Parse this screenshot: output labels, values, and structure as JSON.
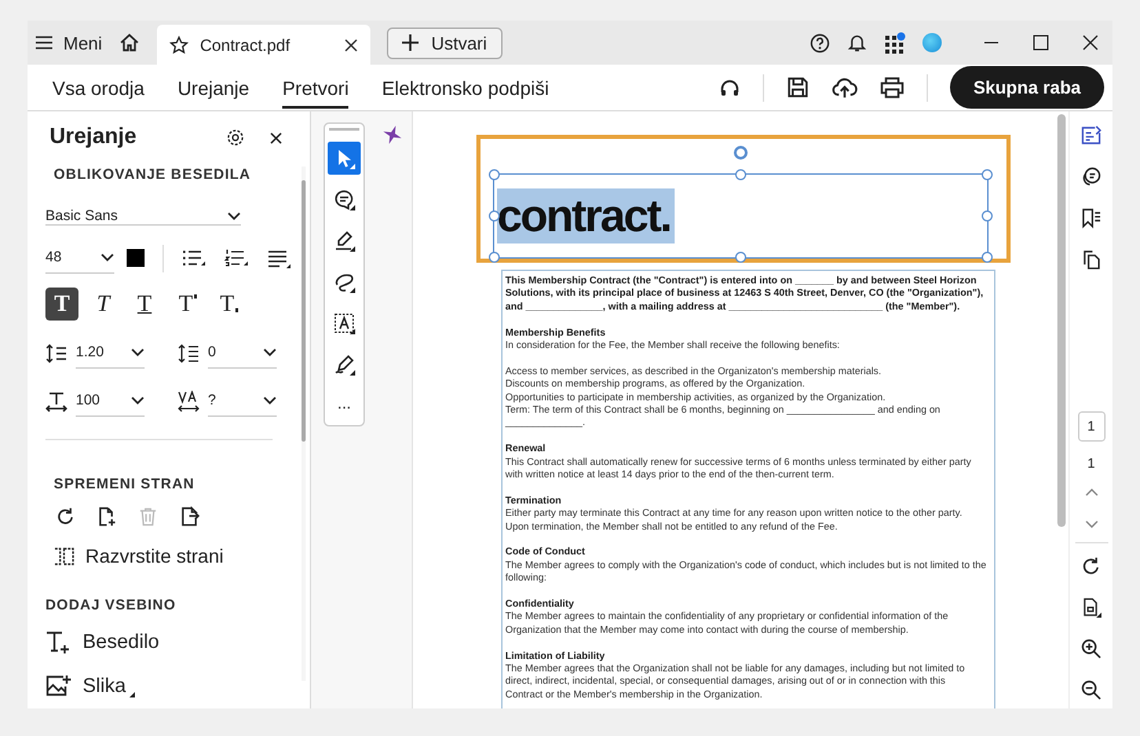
{
  "title_bar": {
    "menu_label": "Meni",
    "tabs": [
      {
        "label": "Contract.pdf",
        "selected": true
      }
    ],
    "create_button": "Ustvari"
  },
  "toolbar": {
    "tabs": [
      {
        "label": "Vsa orodja",
        "selected": false
      },
      {
        "label": "Urejanje",
        "selected": false
      },
      {
        "label": "Pretvori",
        "selected": true
      },
      {
        "label": "Elektronsko podpiši",
        "selected": false
      }
    ],
    "share_button": "Skupna raba"
  },
  "panel": {
    "title": "Urejanje",
    "format_heading": "OBLIKOVANJE BESEDILA",
    "font": "Basic Sans",
    "font_size": "48",
    "text_styles": [
      {
        "kind": "bold",
        "glyph": "T",
        "selected": true
      },
      {
        "kind": "italic",
        "glyph": "T",
        "selected": false
      },
      {
        "kind": "underline",
        "glyph": "T",
        "selected": false
      },
      {
        "kind": "superscript",
        "glyph": "T",
        "selected": false
      },
      {
        "kind": "subscript",
        "glyph": "T",
        "selected": false
      }
    ],
    "line_spacing": "1.20",
    "paragraph_spacing": "0",
    "horizontal_scale": "100",
    "character_spacing": "?",
    "page_heading": "SPREMENI STRAN",
    "page_tools": [
      {
        "kind": "rotate",
        "disabled": false
      },
      {
        "kind": "insert",
        "disabled": false
      },
      {
        "kind": "delete",
        "disabled": true
      },
      {
        "kind": "extract",
        "disabled": false
      }
    ],
    "organize_label": "Razvrstite strani",
    "add_heading": "DODAJ VSEBINO",
    "add_text": "Besedilo",
    "add_image": "Slika"
  },
  "tools": {
    "items": [
      {
        "kind": "select",
        "selected": true
      },
      {
        "kind": "comment",
        "selected": false
      },
      {
        "kind": "highlight",
        "selected": false
      },
      {
        "kind": "draw",
        "selected": false
      },
      {
        "kind": "textbox",
        "selected": false
      },
      {
        "kind": "sign",
        "selected": false
      }
    ],
    "more": "..."
  },
  "document": {
    "heading": "contract.",
    "heading_selected": true,
    "blocks": [
      {
        "kind": "bold",
        "lines": [
          "This Membership Contract (the \"Contract\") is entered into on _______ by and between Steel Horizon",
          "Solutions, with its principal place of business at 12463 S 40th Street, Denver, CO (the \"Organization\"),",
          "and ______________, with a mailing address at ____________________________ (the \"Member\")."
        ]
      },
      {
        "kind": "section",
        "heading": "Membership Benefits",
        "lines": [
          "In consideration for the Fee, the Member shall receive the following benefits:"
        ]
      },
      {
        "kind": "plain",
        "lines": [
          "Access to member services, as described in the Organizaton's membership materials.",
          "Discounts on membership programs, as offered by the Organization.",
          "Opportunities to participate in membership activities, as organized by the Organization.",
          "Term: The term of this Contract shall be 6 months, beginning on ________________ and ending on",
          "______________."
        ]
      },
      {
        "kind": "section",
        "heading": "Renewal",
        "lines": [
          "This Contract shall automatically renew for successive terms of 6 months unless terminated by either party",
          "with written notice at least 14 days prior to the end of the then-current term."
        ]
      },
      {
        "kind": "section",
        "heading": "Termination",
        "lines": [
          "Either party may terminate this Contract at any time for any reason upon written notice to the other party.",
          "Upon termination, the Member shall not be entitled to any refund of the Fee."
        ]
      },
      {
        "kind": "section",
        "heading": "Code of Conduct",
        "lines": [
          "The Member agrees to comply with the Organization's code of conduct, which includes but is not limited to the",
          "following:"
        ]
      },
      {
        "kind": "section",
        "heading": "Confidentiality",
        "lines": [
          "The Member agrees to maintain the confidentiality of any proprietary or confidential information of the",
          "Organization that the Member may come into contact with during the course of membership."
        ]
      },
      {
        "kind": "section",
        "heading": "Limitation of Liability",
        "lines": [
          "The Member agrees that the Organization shall not be liable for any damages, including but not limited to",
          "direct, indirect, incidental, special, or consequential damages, arising out of or in connection with this",
          "Contract or the Member's membership in the Organization."
        ]
      }
    ]
  },
  "rail": {
    "page_input": "1",
    "page_total": "1"
  }
}
